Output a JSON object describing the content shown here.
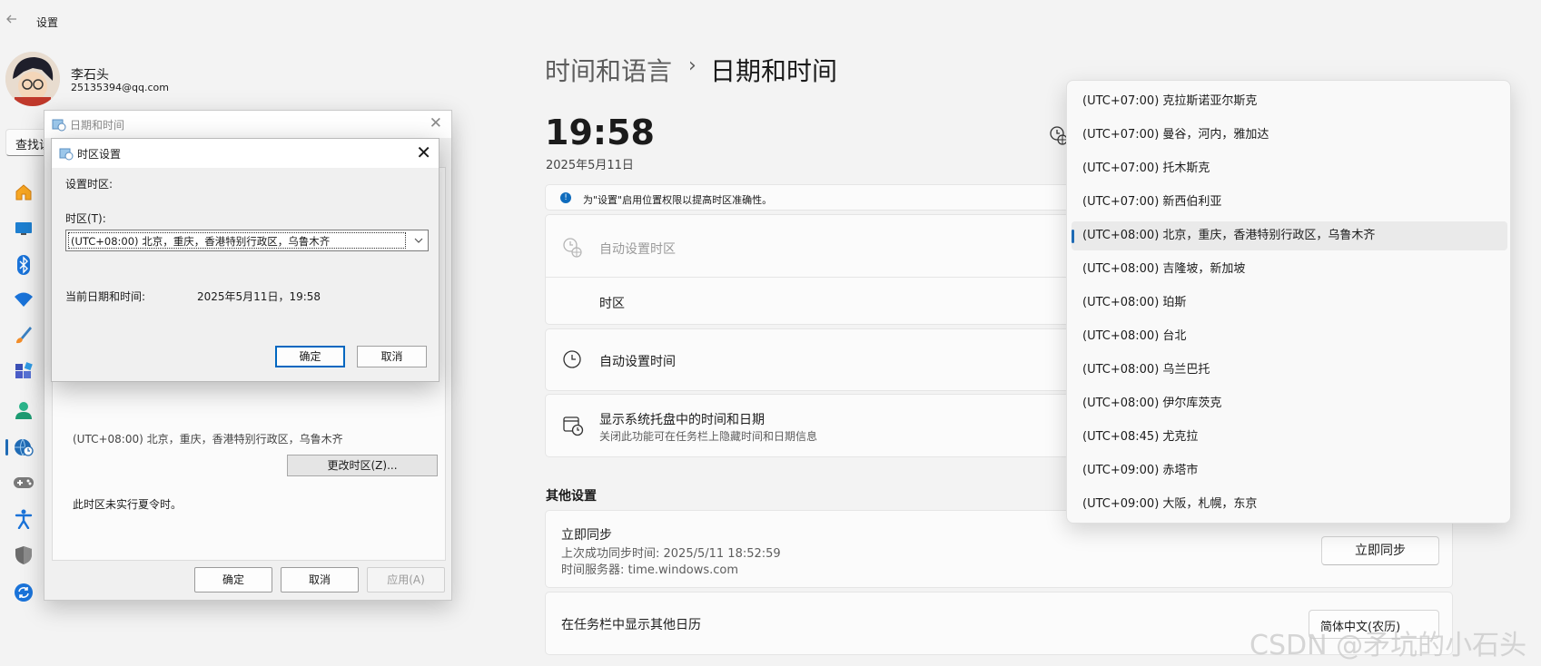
{
  "app": {
    "title": "设置",
    "back_icon": "back-arrow-icon"
  },
  "user": {
    "name": "李石头",
    "email": "25135394@qq.com"
  },
  "search": {
    "text": "查找设"
  },
  "nav": {
    "items": [
      {
        "name": "home",
        "icon": "home-icon"
      },
      {
        "name": "system",
        "icon": "monitor-icon"
      },
      {
        "name": "bluetooth",
        "icon": "bluetooth-icon"
      },
      {
        "name": "network",
        "icon": "wifi-icon"
      },
      {
        "name": "personalization",
        "icon": "brush-icon"
      },
      {
        "name": "apps",
        "icon": "apps-icon"
      },
      {
        "name": "accounts",
        "icon": "person-icon"
      },
      {
        "name": "time-language",
        "icon": "globe-clock-icon",
        "selected": true
      },
      {
        "name": "gaming",
        "icon": "gamepad-icon"
      },
      {
        "name": "accessibility",
        "icon": "accessibility-icon"
      },
      {
        "name": "privacy",
        "icon": "shield-icon"
      },
      {
        "name": "update",
        "icon": "sync-icon"
      }
    ],
    "accent": "#1f6bb5"
  },
  "dt_dialog": {
    "title": "日期和时间",
    "tz_text": "(UTC+08:00) 北京，重庆，香港特别行政区，乌鲁木齐",
    "change_tz_button": "更改时区(Z)...",
    "dst_text": "此时区未实行夏令时。",
    "ok": "确定",
    "cancel": "取消",
    "apply": "应用(A)"
  },
  "tz_dialog": {
    "title": "时区设置",
    "set_label": "设置时区:",
    "tz_label": "时区(T):",
    "selected": "(UTC+08:00) 北京，重庆，香港特别行政区，乌鲁木齐",
    "current_label": "当前日期和时间:",
    "current_value": "2025年5月11日，19:58",
    "ok": "确定",
    "cancel": "取消"
  },
  "main": {
    "breadcrumb_parent": "时间和语言",
    "breadcrumb_sep": "›",
    "breadcrumb_current": "日期和时间",
    "clock": "19:58",
    "date": "2025年5月11日",
    "info_bar": "为\"设置\"启用位置权限以提高时区准确性。",
    "auto_tz": "自动设置时区",
    "tz": "时区",
    "auto_time": "自动设置时间",
    "tray_title": "显示系统托盘中的时间和日期",
    "tray_sub": "关闭此功能可在任务栏上隐藏时间和日期信息",
    "other_heading": "其他设置",
    "sync_title": "立即同步",
    "sync_last": "上次成功同步时间: 2025/5/11 18:52:59",
    "sync_server": "时间服务器: time.windows.com",
    "sync_button": "立即同步",
    "cal_label": "在任务栏中显示其他日历",
    "cal_value": "简体中文(农历)"
  },
  "dropdown": {
    "items": [
      "(UTC+07:00) 克拉斯诺亚尔斯克",
      "(UTC+07:00) 曼谷，河内，雅加达",
      "(UTC+07:00) 托木斯克",
      "(UTC+07:00) 新西伯利亚",
      "(UTC+08:00) 北京，重庆，香港特别行政区，乌鲁木齐",
      "(UTC+08:00) 吉隆坡，新加坡",
      "(UTC+08:00) 珀斯",
      "(UTC+08:00) 台北",
      "(UTC+08:00) 乌兰巴托",
      "(UTC+08:00) 伊尔库茨克",
      "(UTC+08:45) 尤克拉",
      "(UTC+09:00) 赤塔市",
      "(UTC+09:00) 大阪，札幌，东京"
    ],
    "selected_index": 4
  },
  "watermark": "CSDN @矛坑的小石头"
}
